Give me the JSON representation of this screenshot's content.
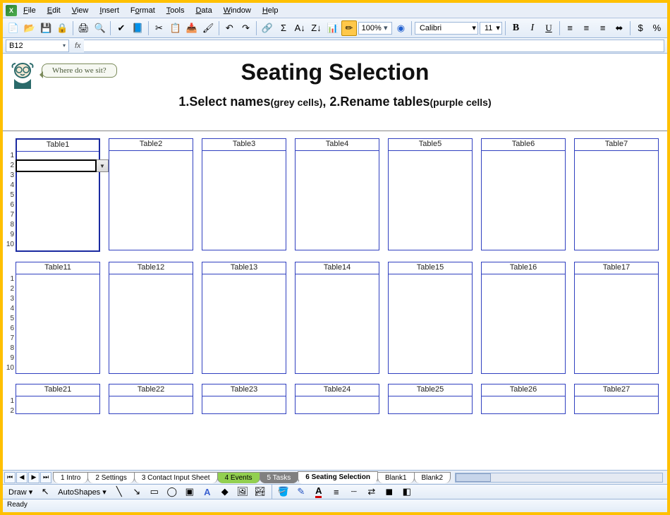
{
  "menu": {
    "items": [
      "File",
      "Edit",
      "View",
      "Insert",
      "Format",
      "Tools",
      "Data",
      "Window",
      "Help"
    ]
  },
  "toolbar": {
    "zoom": "100%",
    "font": "Calibri",
    "size": "11"
  },
  "namebox": "B12",
  "formula": "",
  "header": {
    "speech": "Where do we sit?",
    "title": "Seating Selection",
    "sub_a": "1.Select names",
    "sub_a_paren": "(grey cells)",
    "sub_sep": ",  ",
    "sub_b": "2.Rename tables",
    "sub_b_paren": "(purple cells)"
  },
  "rows1": [
    "1",
    "2",
    "3",
    "4",
    "5",
    "6",
    "7",
    "8",
    "9",
    "10"
  ],
  "rows2": [
    "1",
    "2",
    "3",
    "4",
    "5",
    "6",
    "7",
    "8",
    "9",
    "10"
  ],
  "rows3": [
    "1",
    "2"
  ],
  "tablesRow1": [
    "Table1",
    "Table2",
    "Table3",
    "Table4",
    "Table5",
    "Table6",
    "Table7"
  ],
  "tablesRow2": [
    "Table11",
    "Table12",
    "Table13",
    "Table14",
    "Table15",
    "Table16",
    "Table17"
  ],
  "tablesRow3": [
    "Table21",
    "Table22",
    "Table23",
    "Table24",
    "Table25",
    "Table26",
    "Table27"
  ],
  "tabs": {
    "t1": "1 Intro",
    "t2": "2 Settings",
    "t3": "3 Contact Input Sheet",
    "t4": "4 Events",
    "t5": "5 Tasks",
    "t6": "6 Seating Selection",
    "t7": "Blank1",
    "t8": "Blank2"
  },
  "drawbar": {
    "draw": "Draw",
    "autoshapes": "AutoShapes"
  },
  "status": "Ready"
}
